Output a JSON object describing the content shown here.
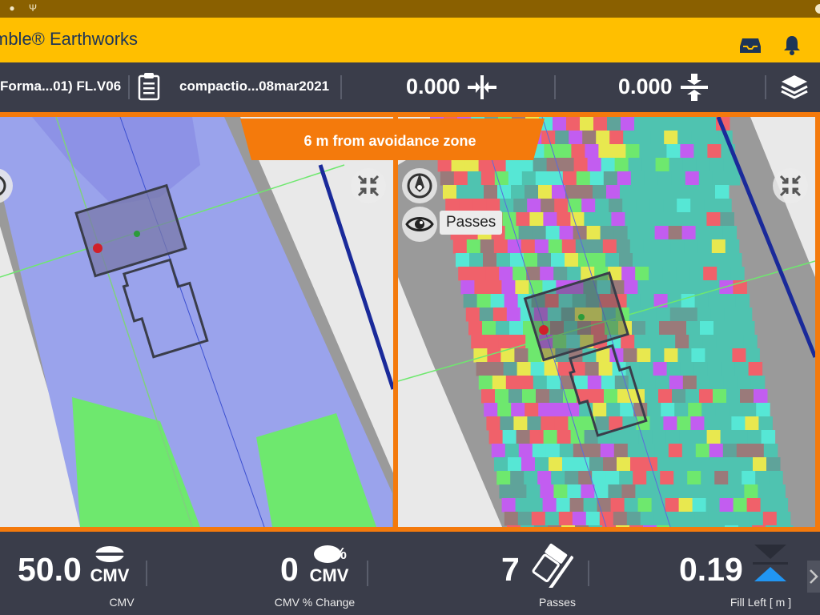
{
  "app": {
    "title": "mble® Earthworks"
  },
  "toolbar": {
    "design": "Forma...01) FL.V06",
    "project": "compactio...08mar2021",
    "horizontal_offset": "0.000",
    "vertical_offset": "0.000"
  },
  "banner": {
    "text": "6 m from avoidance zone"
  },
  "map_right": {
    "layer_label": "Passes"
  },
  "bottom": {
    "items": [
      {
        "value": "50.0",
        "icon_text": "CMV",
        "caption": "CMV"
      },
      {
        "value": "0",
        "icon_text": "CMV",
        "caption": "CMV % Change"
      },
      {
        "value": "7",
        "caption": "Passes"
      },
      {
        "value": "0.19",
        "caption": "Fill Left  [ m ]"
      }
    ],
    "page_dots": {
      "count": 8,
      "active": 0
    }
  },
  "icons": {
    "status_left": [
      "android-icon",
      "usb-icon"
    ],
    "appbar": [
      "inbox-icon",
      "bell-icon"
    ],
    "toolbar": [
      "clipboard-icon",
      "horizontal-offset-icon",
      "vertical-offset-icon",
      "layers-icon"
    ],
    "map": [
      "collapse-icon",
      "compass-icon",
      "eye-icon"
    ],
    "bottom": [
      "cmv-icon",
      "cmv-percent-icon",
      "passes-roller-icon",
      "fill-cut-icon",
      "chevron-right-icon"
    ]
  },
  "colors": {
    "accent": "#ffbf00",
    "warning": "#f47a0c",
    "panel": "#3a3d4a",
    "brand_text": "#1d3557",
    "fill_indicator": "#2196f3",
    "design_surface": "#9aa3ec",
    "compaction_green": "#6ee86e",
    "passes_cyan": "#56e7d5",
    "passes_red": "#f0616a"
  }
}
